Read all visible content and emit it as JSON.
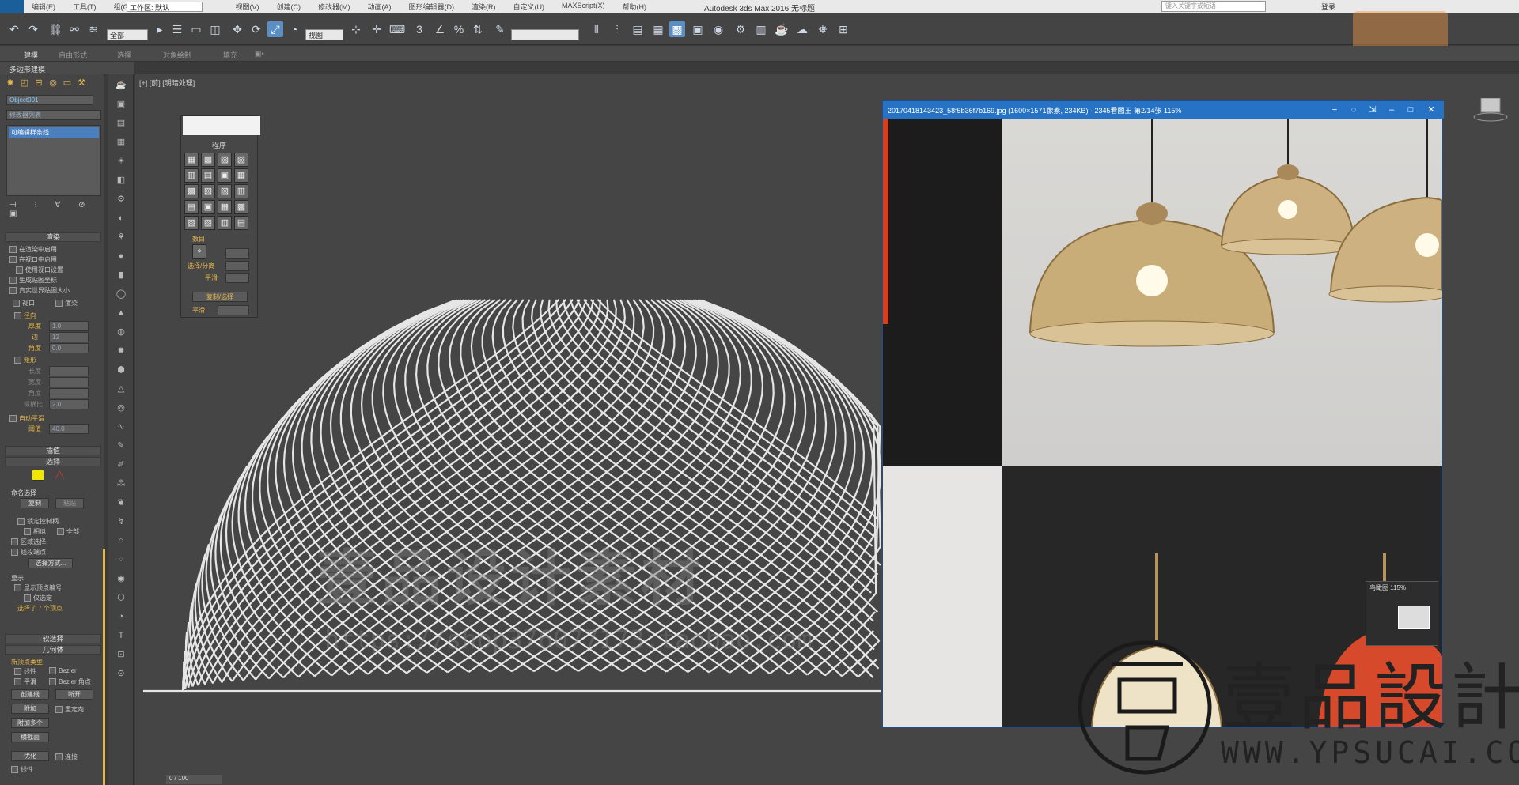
{
  "app": {
    "title": "Autodesk 3ds Max 2016    无标题",
    "icon_label": "MAX",
    "workspace": "工作区: 默认",
    "search_placeholder": "键入关键字或短语",
    "login": "登录",
    "menu": [
      "编辑(E)",
      "工具(T)",
      "组(G)",
      "视图(V)",
      "创建(C)",
      "修改器(M)",
      "动画(A)",
      "图形编辑器(D)",
      "渲染(R)",
      "自定义(U)",
      "MAXScript(X)",
      "帮助(H)"
    ]
  },
  "toolbar": {
    "selection_filter": "全部",
    "view_select": "视图"
  },
  "ribbon": {
    "tabs": [
      "建模",
      "自由形式",
      "选择",
      "对象绘制",
      "填充"
    ],
    "subtitle": "多边形建模"
  },
  "command_panel": {
    "name_field": "Object001",
    "modifier_list": "修改器列表",
    "stack_item": "可编辑样条线",
    "render_rollout": "渲染",
    "render_options": [
      "在渲染中启用",
      "在视口中启用",
      "使用视口设置",
      "生成贴图坐标",
      "真实世界贴图大小"
    ],
    "viewport_label": "视口",
    "render_label": "渲染",
    "radial_label": "径向",
    "thickness_label": "厚度",
    "thickness_value": "1.0",
    "sides_label": "边",
    "sides_value": "12",
    "angle_label": "角度",
    "angle_value": "0.0",
    "rect_label": "矩形",
    "length_label": "长度",
    "width_label": "宽度",
    "angle2_label": "角度",
    "aspect_label": "纵横比",
    "aspect_value": "2.0",
    "auto_smooth": "自动平滑",
    "threshold_label": "阈值",
    "threshold_value": "40.0",
    "interpolation": "插值",
    "selection": "选择",
    "named_selection": "命名选择",
    "copy": "复制",
    "paste": "粘贴",
    "lock_handles": "锁定控制柄",
    "similar": "相似",
    "all": "全部",
    "area_select": "区域选择",
    "segment_end": "线段端点",
    "select_by": "选择方式...",
    "display": "显示",
    "show_vertex_numbers": "显示顶点编号",
    "selected_only": "仅选定",
    "selected_count": "选择了 7 个顶点",
    "soft_selection": "软选择",
    "geometry": "几何体",
    "new_vertex_type": "新顶点类型",
    "linear": "线性",
    "bezier": "Bezier",
    "smooth": "平滑",
    "bezier_corner": "Bezier 角点",
    "create_line": "创建线",
    "break": "断开",
    "attach": "附加",
    "reorient": "重定向",
    "attach_multiple": "附加多个",
    "cross_section": "横截面",
    "refine": "优化",
    "connect": "连接",
    "linear2": "线性"
  },
  "viewport": {
    "label": "[+] [前] [明暗处理]",
    "watermark_cn": "壹品设计素材",
    "watermark_url": "https://shop376077173.taobao.com"
  },
  "lattice_panel": {
    "search_placeholder": "",
    "header": "程序",
    "divide_label": "数目",
    "spacing_label": "选择/分离",
    "scale_label": "平滑",
    "button_label": "复制/选择",
    "bottom_label": "平滑"
  },
  "viewer": {
    "title": "20170418143423_58f5b36f7b169.jpg  (1600×1571像素, 234KB) - 2345看图王  第2/14张 115%",
    "nav_label": "鸟瞰图 115%"
  },
  "brand": {
    "name_cn": "壹品設計",
    "url": "WWW.YPSUCAI.COM"
  },
  "status": {
    "coord": "0 / 100"
  },
  "colors": {
    "accent": "#5b8fc4",
    "viewer_titlebar": "#2673c6",
    "spline": "#e8e8e8",
    "orange": "#e5b64a"
  }
}
